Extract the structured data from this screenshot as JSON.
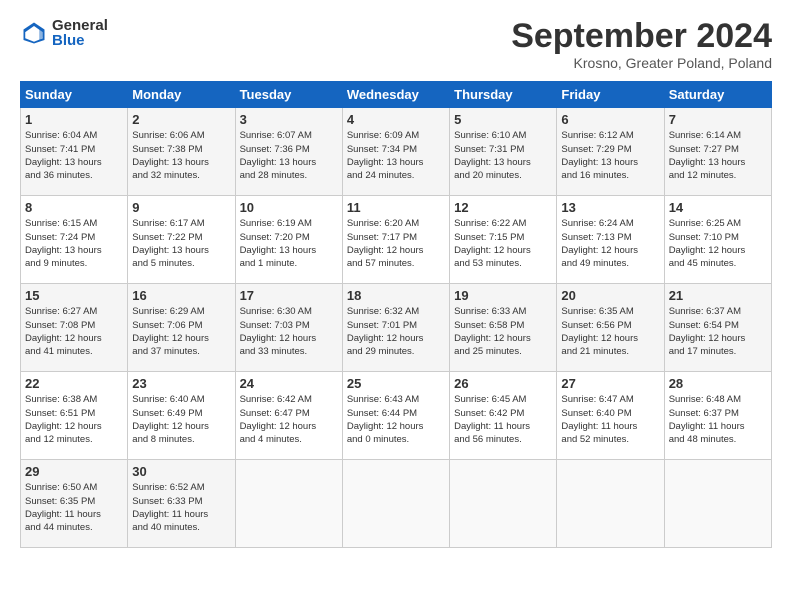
{
  "header": {
    "logo_general": "General",
    "logo_blue": "Blue",
    "month_title": "September 2024",
    "location": "Krosno, Greater Poland, Poland"
  },
  "days_of_week": [
    "Sunday",
    "Monday",
    "Tuesday",
    "Wednesday",
    "Thursday",
    "Friday",
    "Saturday"
  ],
  "weeks": [
    [
      {
        "day": "1",
        "info": "Sunrise: 6:04 AM\nSunset: 7:41 PM\nDaylight: 13 hours\nand 36 minutes."
      },
      {
        "day": "2",
        "info": "Sunrise: 6:06 AM\nSunset: 7:38 PM\nDaylight: 13 hours\nand 32 minutes."
      },
      {
        "day": "3",
        "info": "Sunrise: 6:07 AM\nSunset: 7:36 PM\nDaylight: 13 hours\nand 28 minutes."
      },
      {
        "day": "4",
        "info": "Sunrise: 6:09 AM\nSunset: 7:34 PM\nDaylight: 13 hours\nand 24 minutes."
      },
      {
        "day": "5",
        "info": "Sunrise: 6:10 AM\nSunset: 7:31 PM\nDaylight: 13 hours\nand 20 minutes."
      },
      {
        "day": "6",
        "info": "Sunrise: 6:12 AM\nSunset: 7:29 PM\nDaylight: 13 hours\nand 16 minutes."
      },
      {
        "day": "7",
        "info": "Sunrise: 6:14 AM\nSunset: 7:27 PM\nDaylight: 13 hours\nand 12 minutes."
      }
    ],
    [
      {
        "day": "8",
        "info": "Sunrise: 6:15 AM\nSunset: 7:24 PM\nDaylight: 13 hours\nand 9 minutes."
      },
      {
        "day": "9",
        "info": "Sunrise: 6:17 AM\nSunset: 7:22 PM\nDaylight: 13 hours\nand 5 minutes."
      },
      {
        "day": "10",
        "info": "Sunrise: 6:19 AM\nSunset: 7:20 PM\nDaylight: 13 hours\nand 1 minute."
      },
      {
        "day": "11",
        "info": "Sunrise: 6:20 AM\nSunset: 7:17 PM\nDaylight: 12 hours\nand 57 minutes."
      },
      {
        "day": "12",
        "info": "Sunrise: 6:22 AM\nSunset: 7:15 PM\nDaylight: 12 hours\nand 53 minutes."
      },
      {
        "day": "13",
        "info": "Sunrise: 6:24 AM\nSunset: 7:13 PM\nDaylight: 12 hours\nand 49 minutes."
      },
      {
        "day": "14",
        "info": "Sunrise: 6:25 AM\nSunset: 7:10 PM\nDaylight: 12 hours\nand 45 minutes."
      }
    ],
    [
      {
        "day": "15",
        "info": "Sunrise: 6:27 AM\nSunset: 7:08 PM\nDaylight: 12 hours\nand 41 minutes."
      },
      {
        "day": "16",
        "info": "Sunrise: 6:29 AM\nSunset: 7:06 PM\nDaylight: 12 hours\nand 37 minutes."
      },
      {
        "day": "17",
        "info": "Sunrise: 6:30 AM\nSunset: 7:03 PM\nDaylight: 12 hours\nand 33 minutes."
      },
      {
        "day": "18",
        "info": "Sunrise: 6:32 AM\nSunset: 7:01 PM\nDaylight: 12 hours\nand 29 minutes."
      },
      {
        "day": "19",
        "info": "Sunrise: 6:33 AM\nSunset: 6:58 PM\nDaylight: 12 hours\nand 25 minutes."
      },
      {
        "day": "20",
        "info": "Sunrise: 6:35 AM\nSunset: 6:56 PM\nDaylight: 12 hours\nand 21 minutes."
      },
      {
        "day": "21",
        "info": "Sunrise: 6:37 AM\nSunset: 6:54 PM\nDaylight: 12 hours\nand 17 minutes."
      }
    ],
    [
      {
        "day": "22",
        "info": "Sunrise: 6:38 AM\nSunset: 6:51 PM\nDaylight: 12 hours\nand 12 minutes."
      },
      {
        "day": "23",
        "info": "Sunrise: 6:40 AM\nSunset: 6:49 PM\nDaylight: 12 hours\nand 8 minutes."
      },
      {
        "day": "24",
        "info": "Sunrise: 6:42 AM\nSunset: 6:47 PM\nDaylight: 12 hours\nand 4 minutes."
      },
      {
        "day": "25",
        "info": "Sunrise: 6:43 AM\nSunset: 6:44 PM\nDaylight: 12 hours\nand 0 minutes."
      },
      {
        "day": "26",
        "info": "Sunrise: 6:45 AM\nSunset: 6:42 PM\nDaylight: 11 hours\nand 56 minutes."
      },
      {
        "day": "27",
        "info": "Sunrise: 6:47 AM\nSunset: 6:40 PM\nDaylight: 11 hours\nand 52 minutes."
      },
      {
        "day": "28",
        "info": "Sunrise: 6:48 AM\nSunset: 6:37 PM\nDaylight: 11 hours\nand 48 minutes."
      }
    ],
    [
      {
        "day": "29",
        "info": "Sunrise: 6:50 AM\nSunset: 6:35 PM\nDaylight: 11 hours\nand 44 minutes."
      },
      {
        "day": "30",
        "info": "Sunrise: 6:52 AM\nSunset: 6:33 PM\nDaylight: 11 hours\nand 40 minutes."
      },
      {
        "day": "",
        "info": ""
      },
      {
        "day": "",
        "info": ""
      },
      {
        "day": "",
        "info": ""
      },
      {
        "day": "",
        "info": ""
      },
      {
        "day": "",
        "info": ""
      }
    ]
  ]
}
